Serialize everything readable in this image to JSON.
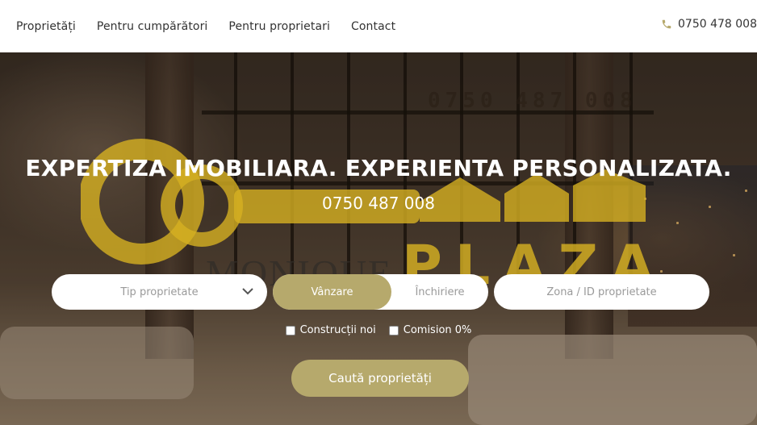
{
  "nav": {
    "items": [
      {
        "label": "Proprietăți"
      },
      {
        "label": "Pentru cumpărători"
      },
      {
        "label": "Pentru proprietari"
      },
      {
        "label": "Contact"
      }
    ]
  },
  "header": {
    "phone": "0750 478 008",
    "phone_icon": "phone-icon"
  },
  "watermark": {
    "phone": "0750 487 008",
    "brand_part1": "MONIQUE",
    "brand_part2": "PLAZA",
    "color": "#d6b022"
  },
  "hero": {
    "title": "EXPERTIZA IMOBILIARA. EXPERIENTA PERSONALIZATA.",
    "phone": "0750 487 008"
  },
  "search": {
    "property_type_placeholder": "Tip proprietate",
    "sale_label": "Vânzare",
    "rent_label": "Închiriere",
    "zone_placeholder": "Zona / ID proprietate",
    "new_constructions_label": "Construcții noi",
    "commission_label": "Comision 0%",
    "submit_label": "Caută proprietăți"
  },
  "colors": {
    "accent": "#b6a96c",
    "header_bg": "#ffffff",
    "phone_icon": "#b6a96c"
  }
}
